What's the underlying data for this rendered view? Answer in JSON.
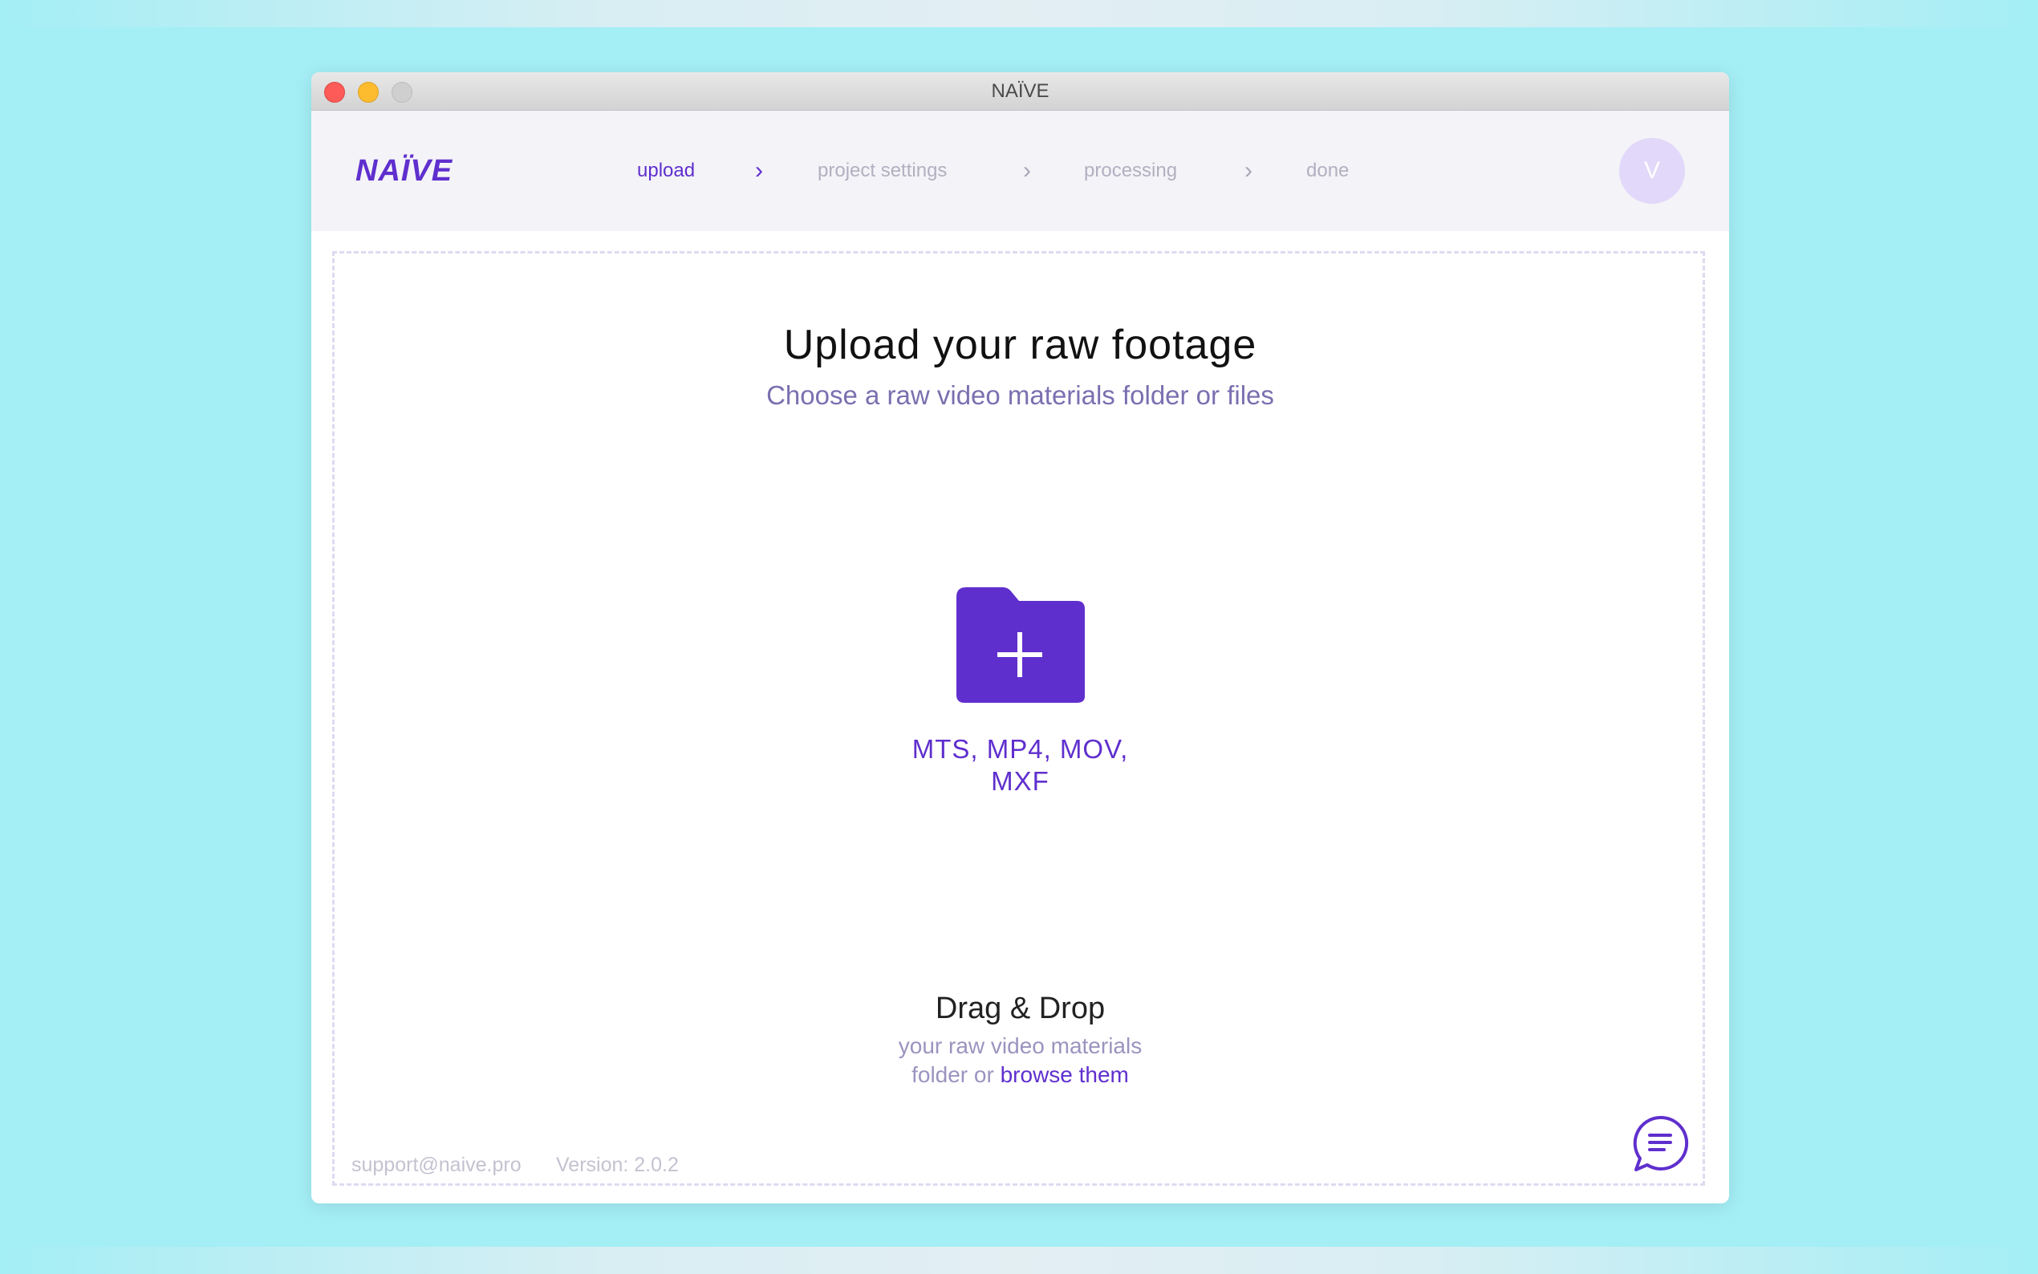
{
  "window": {
    "title": "NAÏVE"
  },
  "header": {
    "logo": "NAÏVE",
    "steps": [
      {
        "label": "upload",
        "active": true
      },
      {
        "label": "project settings",
        "active": false
      },
      {
        "label": "processing",
        "active": false
      },
      {
        "label": "done",
        "active": false
      }
    ],
    "chevron": "›",
    "avatar_initial": "V"
  },
  "main": {
    "title": "Upload your raw footage",
    "subtitle": "Choose a raw video materials folder or files",
    "folder_icon": "folder-plus-icon",
    "formats_line1": "MTS, MP4, MOV,",
    "formats_line2": "MXF",
    "drag_drop_title": "Drag & Drop",
    "drag_drop_line1": "your raw video materials",
    "drag_drop_prefix": "folder or ",
    "browse_link": "browse them"
  },
  "footer": {
    "email": "support@naive.pro",
    "version": "Version: 2.0.2",
    "chat_icon": "chat-bubble-icon"
  },
  "colors": {
    "accent": "#5f2fce",
    "background": "#a4eef5",
    "header_bg": "#f4f3f8",
    "avatar_bg": "#e2d8f9"
  }
}
